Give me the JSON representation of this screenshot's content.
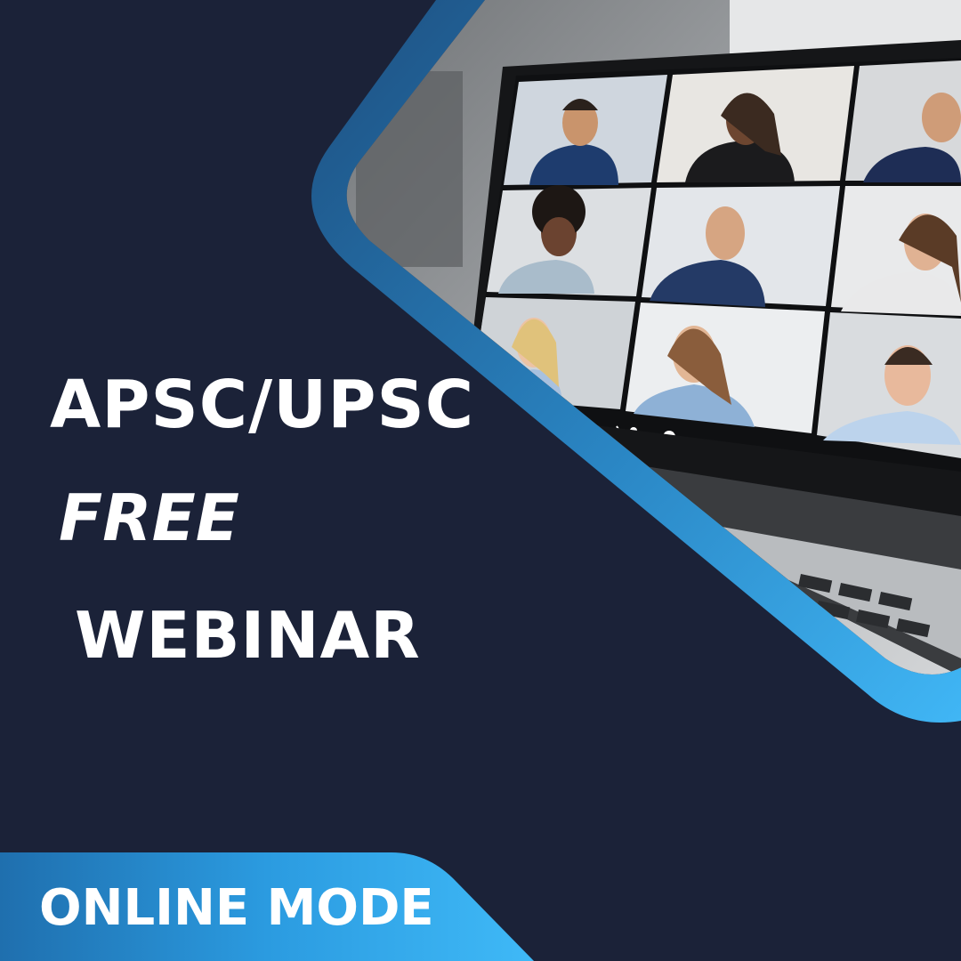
{
  "title": {
    "line1": "APSC/UPSC",
    "line2": "FREE",
    "line3": "WEBINAR"
  },
  "banner": {
    "label": "ONLINE MODE"
  },
  "colors": {
    "background": "#1b2238",
    "accent_light": "#3fb2f2",
    "accent_dark": "#1d5f93",
    "text": "#ffffff"
  },
  "photo": {
    "participants": 9,
    "call_controls": [
      "speaker-icon",
      "microphone-icon",
      "participants-icon",
      "screen-share-icon",
      "camera-icon"
    ]
  }
}
